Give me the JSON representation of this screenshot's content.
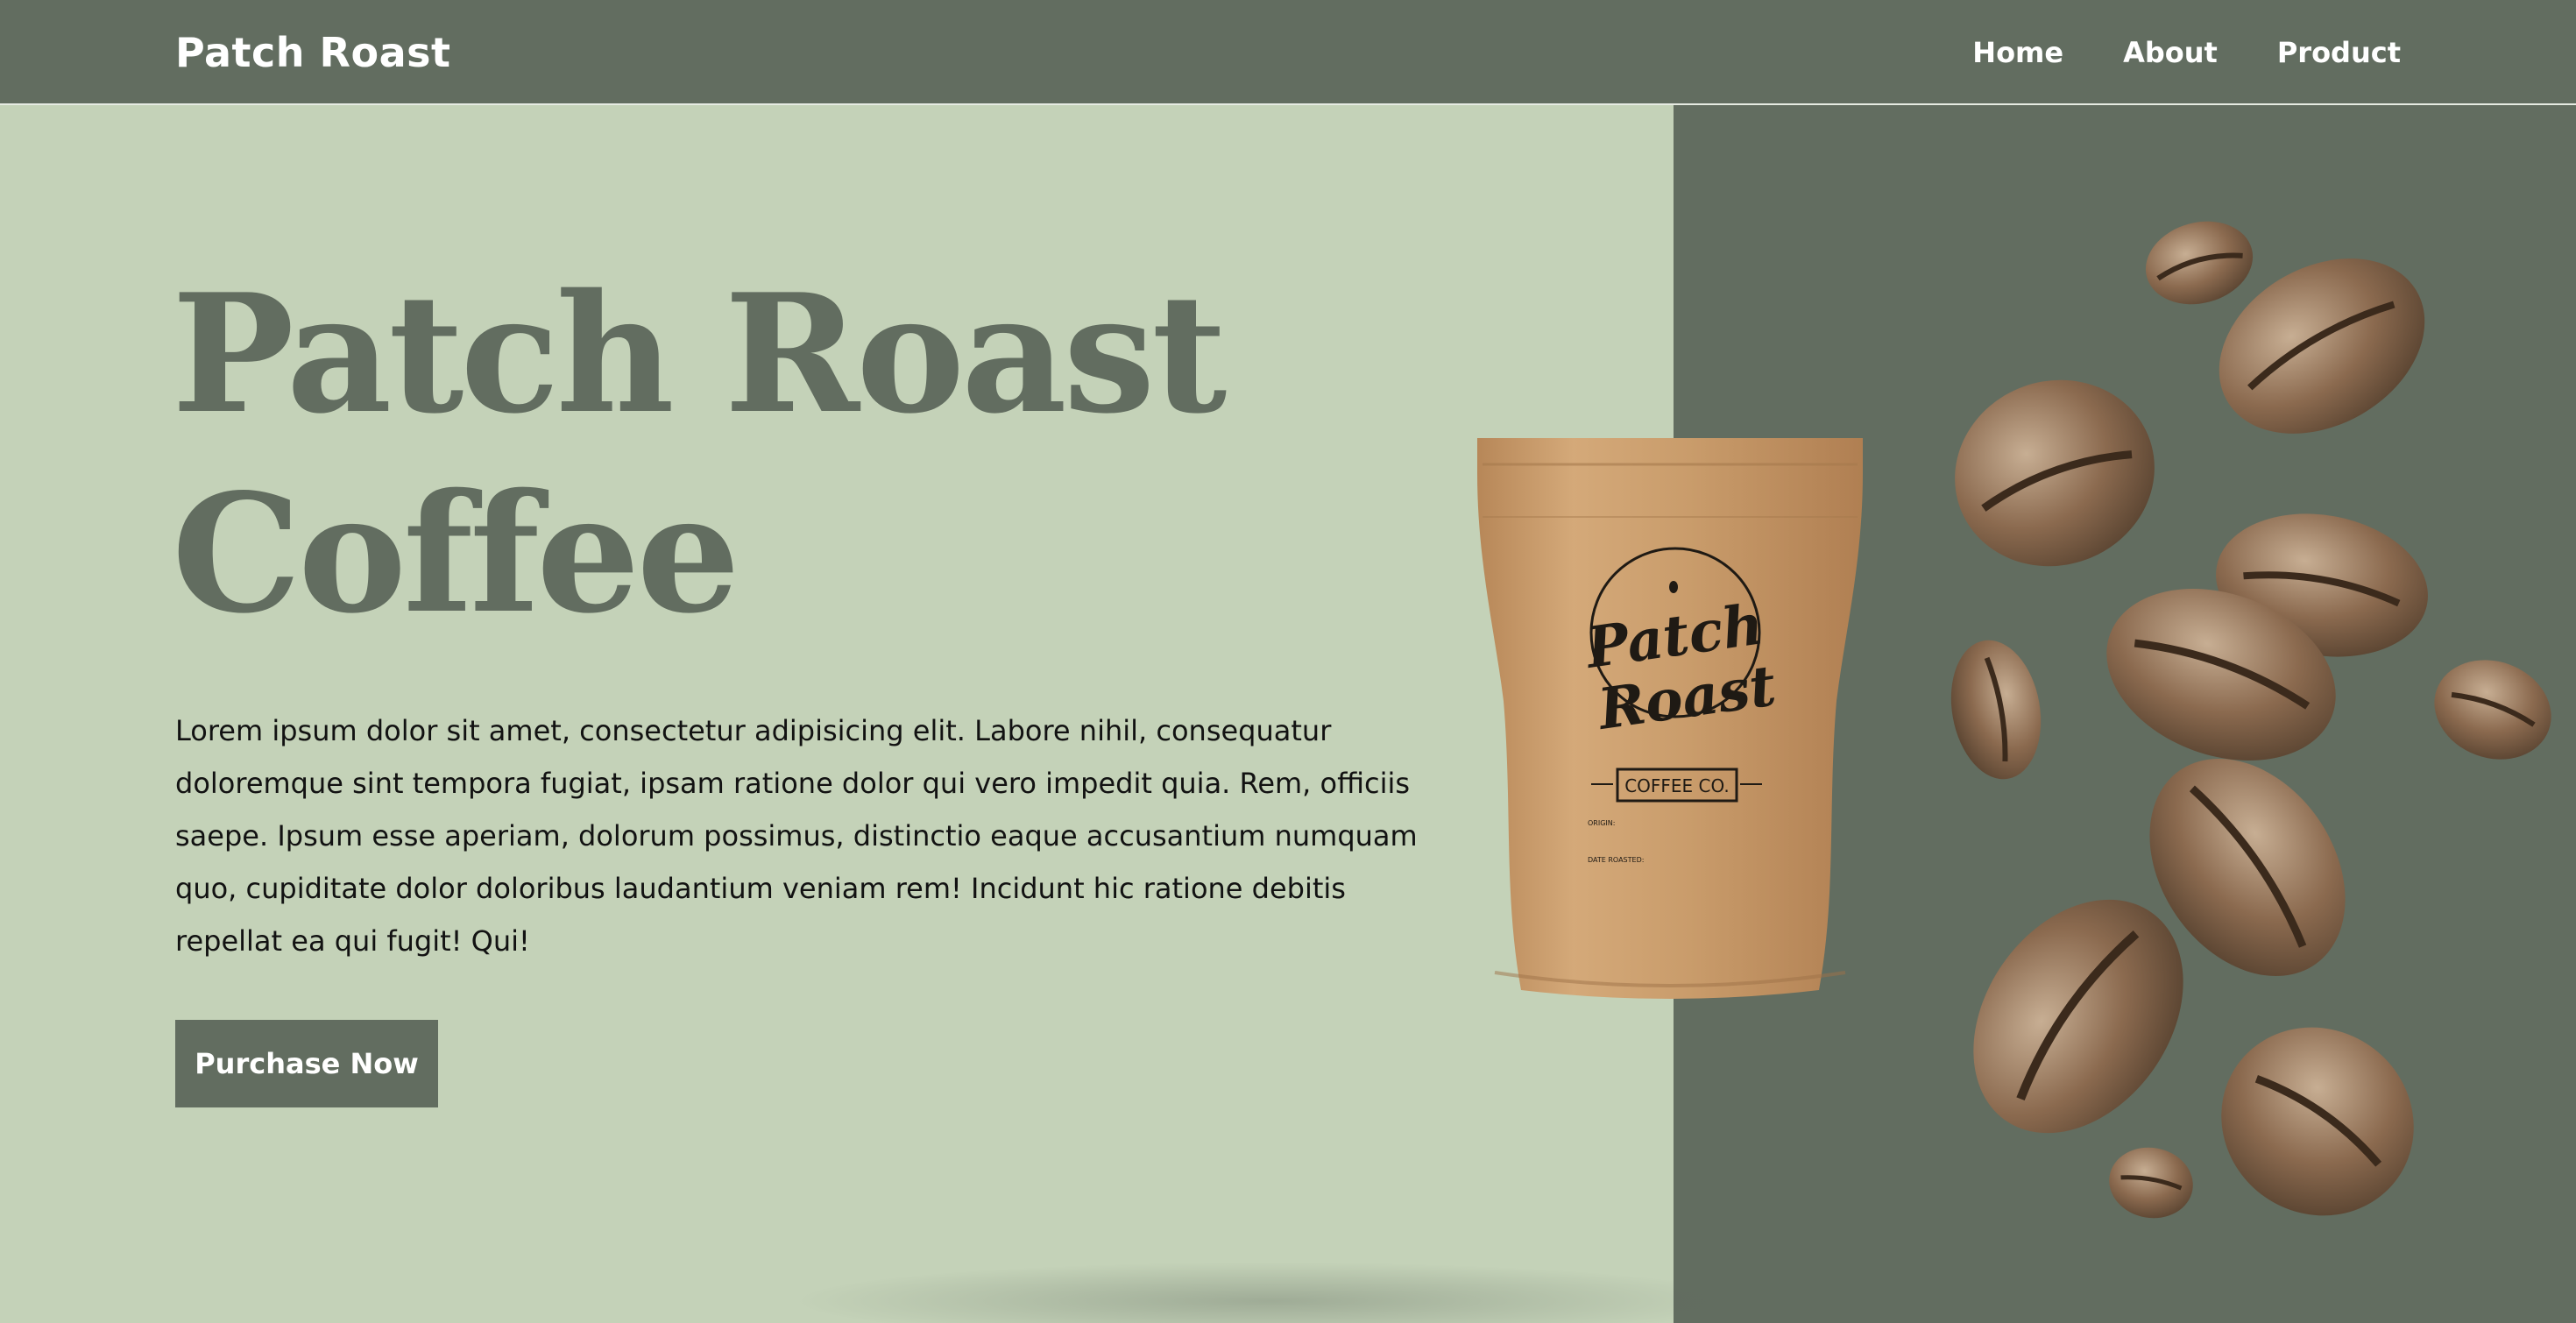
{
  "header": {
    "brand": "Patch Roast",
    "nav": [
      {
        "label": "Home"
      },
      {
        "label": "About"
      },
      {
        "label": "Product"
      }
    ]
  },
  "hero": {
    "title_line1": "Patch Roast",
    "title_line2": "Coffee",
    "description": "Lorem ipsum dolor sit amet, consectetur adipisicing elit. Labore nihil, consequatur doloremque sint tempora fugiat, ipsam ratione dolor qui vero impedit quia. Rem, officiis saepe. Ipsum esse aperiam, dolorum possimus, distinctio eaque accusantium numquam quo, cupiditate dolor doloribus laudantium veniam rem! Incidunt hic ratione debitis repellat ea qui fugit! Qui!",
    "cta_label": "Purchase Now"
  },
  "bag": {
    "logo_line1": "Patch",
    "logo_line2": "Roast",
    "badge": "COFFEE CO.",
    "field1": "ORIGIN:",
    "field2": "DATE ROASTED:"
  },
  "colors": {
    "sage_light": "#c4d2b8",
    "sage_dark": "#626d60",
    "kraft": "#c49a6c",
    "bean": "#8b6a4f"
  }
}
